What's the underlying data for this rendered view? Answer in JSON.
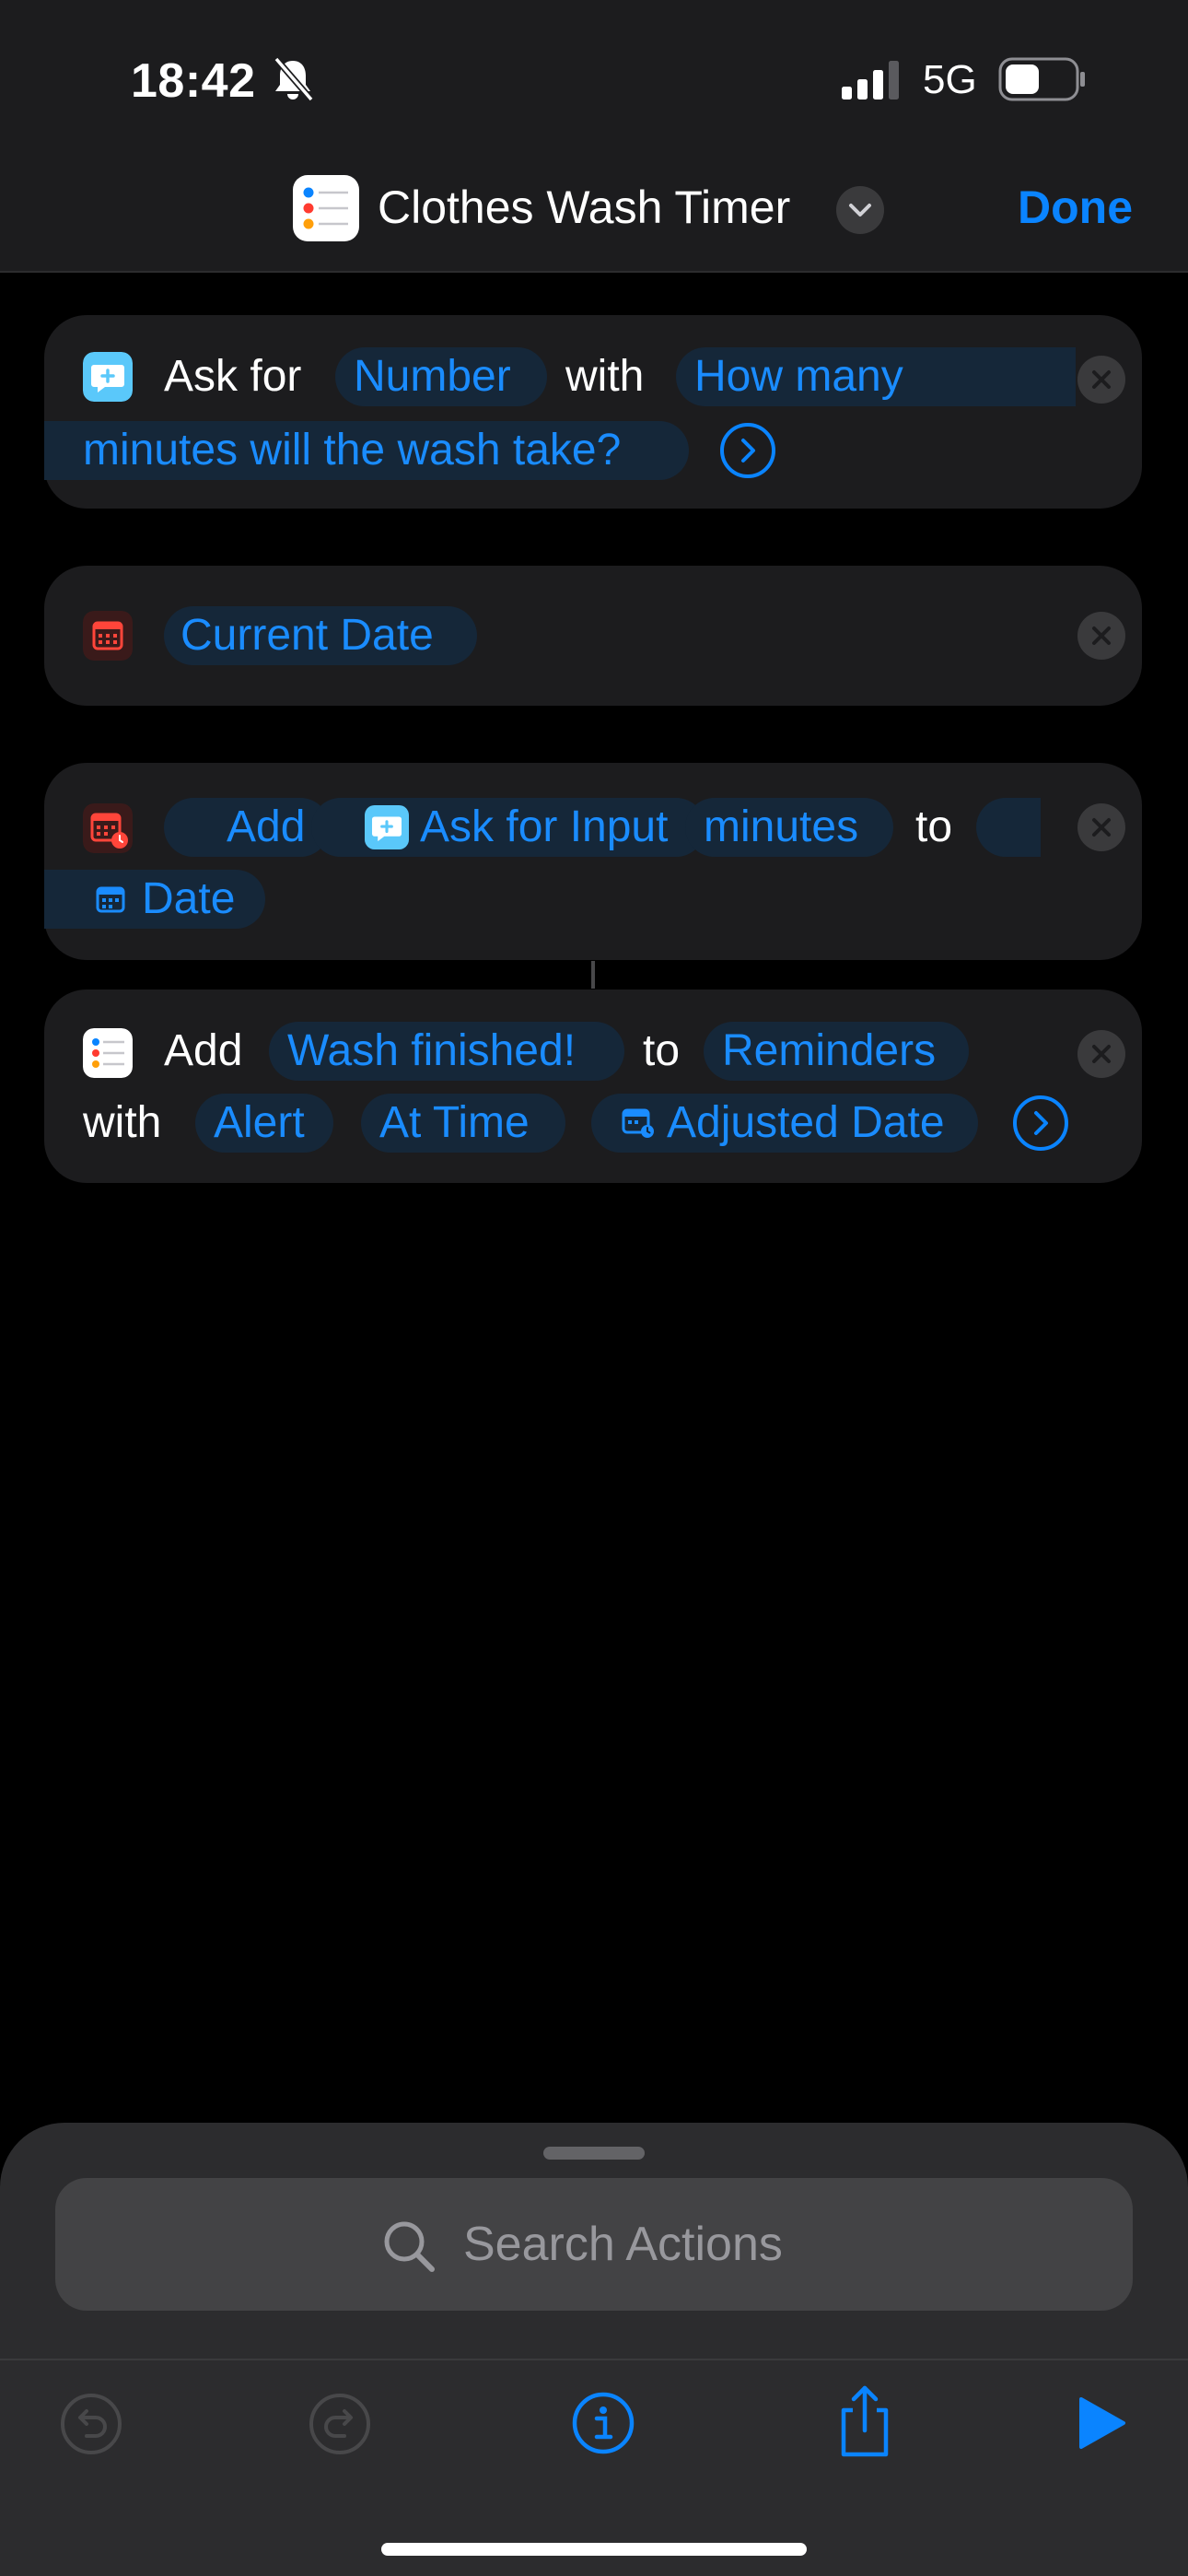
{
  "status_bar": {
    "time": "18:42",
    "network": "5G"
  },
  "nav": {
    "title": "Clothes Wash Timer",
    "done_label": "Done"
  },
  "actions": [
    {
      "ask_label": "Ask for",
      "type_value": "Number",
      "with_label": "with",
      "prompt_line1": "How many",
      "prompt_line2": "minutes will the wash take?"
    },
    {
      "value": "Current Date"
    },
    {
      "add_label": "Add",
      "variable": "Ask for Input",
      "unit": "minutes",
      "to_label": "to",
      "target": "Date"
    },
    {
      "add_label": "Add",
      "reminder_text": "Wash finished!",
      "to_label": "to",
      "list": "Reminders",
      "with_label": "with",
      "alert": "Alert",
      "alert_time": "At Time",
      "date_variable": "Adjusted Date"
    }
  ],
  "search": {
    "placeholder": "Search Actions"
  },
  "icons": [
    "bell-slash-icon",
    "signal-icon",
    "battery-icon",
    "reminders-app-icon",
    "chevron-down-icon",
    "ask-input-icon",
    "calendar-icon",
    "calendar-badge-icon",
    "close-icon",
    "chevron-right-icon",
    "search-icon",
    "undo-icon",
    "redo-icon",
    "info-icon",
    "share-icon",
    "play-icon"
  ],
  "colors": {
    "accent": "#0a84ff",
    "card": "#1c1c1e",
    "pill": "#152739",
    "sheet": "#2c2c2e"
  }
}
